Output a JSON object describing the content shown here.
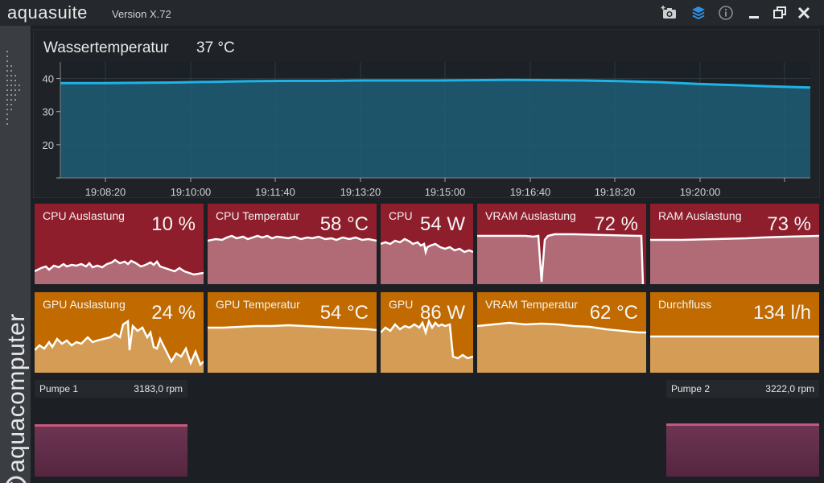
{
  "app": {
    "name": "aquasuite",
    "version": "Version X.72",
    "brand": "aquacomputer"
  },
  "titlebar_icons": [
    "camera-add-icon",
    "layers-icon",
    "info-icon",
    "minimize-icon",
    "restore-icon",
    "close-icon"
  ],
  "water": {
    "title": "Wassertemperatur",
    "value": "37 °C",
    "chart_data": {
      "type": "area",
      "y_ticks": [
        "40",
        "30",
        "20"
      ],
      "ylim": [
        10,
        45
      ],
      "x_ticks": [
        "19:08:20",
        "19:10:00",
        "19:11:40",
        "19:13:20",
        "19:15:00",
        "19:16:40",
        "19:18:20",
        "19:20:00"
      ],
      "series": [
        {
          "values": [
            38.6,
            38.6,
            38.7,
            38.8,
            39.0,
            39.2,
            39.3,
            39.3,
            39.4,
            39.4,
            39.4,
            39.5,
            39.6,
            39.5,
            39.4,
            39.2,
            38.9,
            38.4,
            38.0,
            37.6,
            37.3
          ]
        }
      ],
      "grid": true
    }
  },
  "tiles_row1": [
    {
      "label": "CPU Auslastung",
      "value": "10 %",
      "kind": "cpu-load"
    },
    {
      "label": "CPU Temperatur",
      "value": "58 °C",
      "kind": "cpu-temp"
    },
    {
      "label": "CPU",
      "value": "54 W",
      "kind": "cpu-power"
    },
    {
      "label": "VRAM Auslastung",
      "value": "72 %",
      "kind": "vram-load"
    },
    {
      "label": "RAM Auslastung",
      "value": "73 %",
      "kind": "ram-load"
    }
  ],
  "tiles_row2": [
    {
      "label": "GPU Auslastung",
      "value": "24 %",
      "kind": "gpu-load"
    },
    {
      "label": "GPU Temperatur",
      "value": "54 °C",
      "kind": "gpu-temp"
    },
    {
      "label": "GPU",
      "value": "86 W",
      "kind": "gpu-power"
    },
    {
      "label": "VRAM Temperatur",
      "value": "62 °C",
      "kind": "vram-temp"
    },
    {
      "label": "Durchfluss",
      "value": "134 l/h",
      "kind": "flow"
    }
  ],
  "pumps": [
    {
      "name": "Pumpe 1",
      "rpm": "3183,0 rpm"
    },
    {
      "name": "Pumpe 2",
      "rpm": "3222,0 rpm"
    }
  ],
  "colors": {
    "red_tile": "#8f1e2c",
    "red_fill": "#b06b76",
    "orange_tile": "#c06a00",
    "orange_fill": "#d59c56",
    "water_fill": "#1f5d75",
    "water_line": "#1fb2e6",
    "pump_fill": "#6b3350",
    "pump_line": "#c8577f"
  }
}
